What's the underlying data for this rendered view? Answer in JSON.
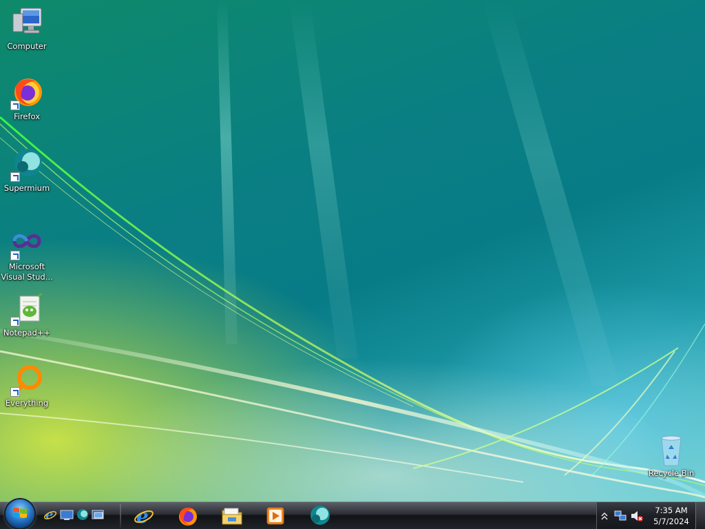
{
  "desktop": {
    "icons": [
      {
        "label": "Computer",
        "icon": "computer-icon"
      },
      {
        "label": "Firefox",
        "icon": "firefox-icon"
      },
      {
        "label": "Supermium",
        "icon": "supermium-icon"
      },
      {
        "label": "Microsoft Visual Stud...",
        "icon": "visual-studio-icon"
      },
      {
        "label": "Notepad++",
        "icon": "notepad-plus-plus-icon"
      },
      {
        "label": "Everything",
        "icon": "everything-icon"
      },
      {
        "label": "Recycle Bin",
        "icon": "recycle-bin-icon"
      }
    ]
  },
  "taskbar": {
    "start": {
      "icon": "windows-flag-icon"
    },
    "quick_launch": [
      {
        "icon": "internet-explorer-icon"
      },
      {
        "icon": "show-desktop-icon"
      },
      {
        "icon": "supermium-icon"
      },
      {
        "icon": "switch-windows-icon"
      }
    ],
    "pinned": [
      {
        "icon": "internet-explorer-icon"
      },
      {
        "icon": "firefox-icon"
      },
      {
        "icon": "file-explorer-icon"
      },
      {
        "icon": "media-player-icon"
      },
      {
        "icon": "supermium-icon"
      }
    ],
    "tray": {
      "icons": [
        "show-hidden-icons-chevron-icon",
        "network-icon",
        "volume-muted-icon"
      ],
      "time": "7:35 AM",
      "date": "5/7/2024"
    }
  },
  "colors": {
    "wallpaper_teal": "#0a7f83",
    "wallpaper_yellow": "#e6f03c",
    "taskbar_dark": "#1c1f24"
  }
}
